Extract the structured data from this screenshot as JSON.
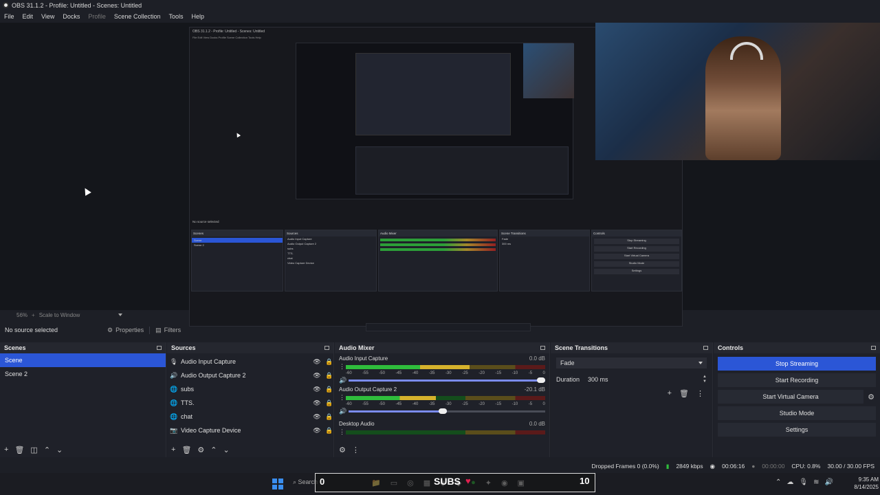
{
  "window": {
    "title": "OBS 31.1.2 - Profile: Untitled - Scenes: Untitled"
  },
  "menu": {
    "items": [
      "File",
      "Edit",
      "View",
      "Docks",
      "Profile",
      "Scene Collection",
      "Tools",
      "Help"
    ]
  },
  "nested": {
    "title": "OBS 31.1.2 - Profile: Untitled - Scenes: Untitled",
    "menu": "File  Edit  View  Docks  Profile  Scene Collection  Tools  Help",
    "no_source": "No source selected",
    "scenes": [
      "Scene",
      "Scene 2"
    ],
    "sources": [
      "Audio Input Capture",
      "Audio Output Capture 2",
      "subs",
      "TTS.",
      "chat",
      "Video Capture Device"
    ],
    "controls": [
      "Stop Streaming",
      "Start Recording",
      "Start Virtual Camera",
      "Studio Mode",
      "Settings"
    ],
    "transitions": {
      "type": "Fade",
      "duration": "300 ms"
    }
  },
  "zoom": {
    "level": "56%",
    "mode": "Scale to Window"
  },
  "context": {
    "no_source": "No source selected",
    "properties": "Properties",
    "filters": "Filters"
  },
  "scenes": {
    "title": "Scenes",
    "items": [
      {
        "label": "Scene",
        "selected": true
      },
      {
        "label": "Scene 2",
        "selected": false
      }
    ]
  },
  "sources": {
    "title": "Sources",
    "items": [
      {
        "label": "Audio Input Capture",
        "icon": "microphone-icon"
      },
      {
        "label": "Audio Output Capture 2",
        "icon": "speaker-icon"
      },
      {
        "label": "subs",
        "icon": "globe-icon"
      },
      {
        "label": "TTS.",
        "icon": "globe-icon"
      },
      {
        "label": "chat",
        "icon": "globe-icon"
      },
      {
        "label": "Video Capture Device",
        "icon": "camera-icon"
      }
    ]
  },
  "mixer": {
    "title": "Audio Mixer",
    "scale": [
      "-60",
      "-55",
      "-50",
      "-45",
      "-40",
      "-35",
      "-30",
      "-25",
      "-20",
      "-15",
      "-10",
      "-5",
      "0"
    ],
    "channels": [
      {
        "name": "Audio Input Capture",
        "db": "0.0 dB",
        "level": 0.62,
        "volume": 1.0
      },
      {
        "name": "Audio Output Capture 2",
        "db": "-20.1 dB",
        "level": 0.45,
        "volume": 0.5
      },
      {
        "name": "Desktop Audio",
        "db": "0.0 dB",
        "level": 0.0,
        "volume": 0.5
      }
    ]
  },
  "transitions": {
    "title": "Scene Transitions",
    "type": "Fade",
    "duration_label": "Duration",
    "duration_value": "300 ms"
  },
  "controls": {
    "title": "Controls",
    "stop_streaming": "Stop Streaming",
    "start_recording": "Start Recording",
    "start_virtual_camera": "Start Virtual Camera",
    "studio_mode": "Studio Mode",
    "settings": "Settings"
  },
  "status": {
    "dropped_frames": "Dropped Frames 0 (0.0%)",
    "bitrate": "2849 kbps",
    "stream_time": "00:06:16",
    "rec_time": "00:00:00",
    "cpu": "CPU: 0.8%",
    "fps": "30.00 / 30.00 FPS"
  },
  "taskbar": {
    "search": "Search",
    "overlay_number": "0",
    "overlay_subs": "SUBS",
    "overlay_count": "10",
    "time": "9:35 AM",
    "date": "8/14/2025"
  }
}
